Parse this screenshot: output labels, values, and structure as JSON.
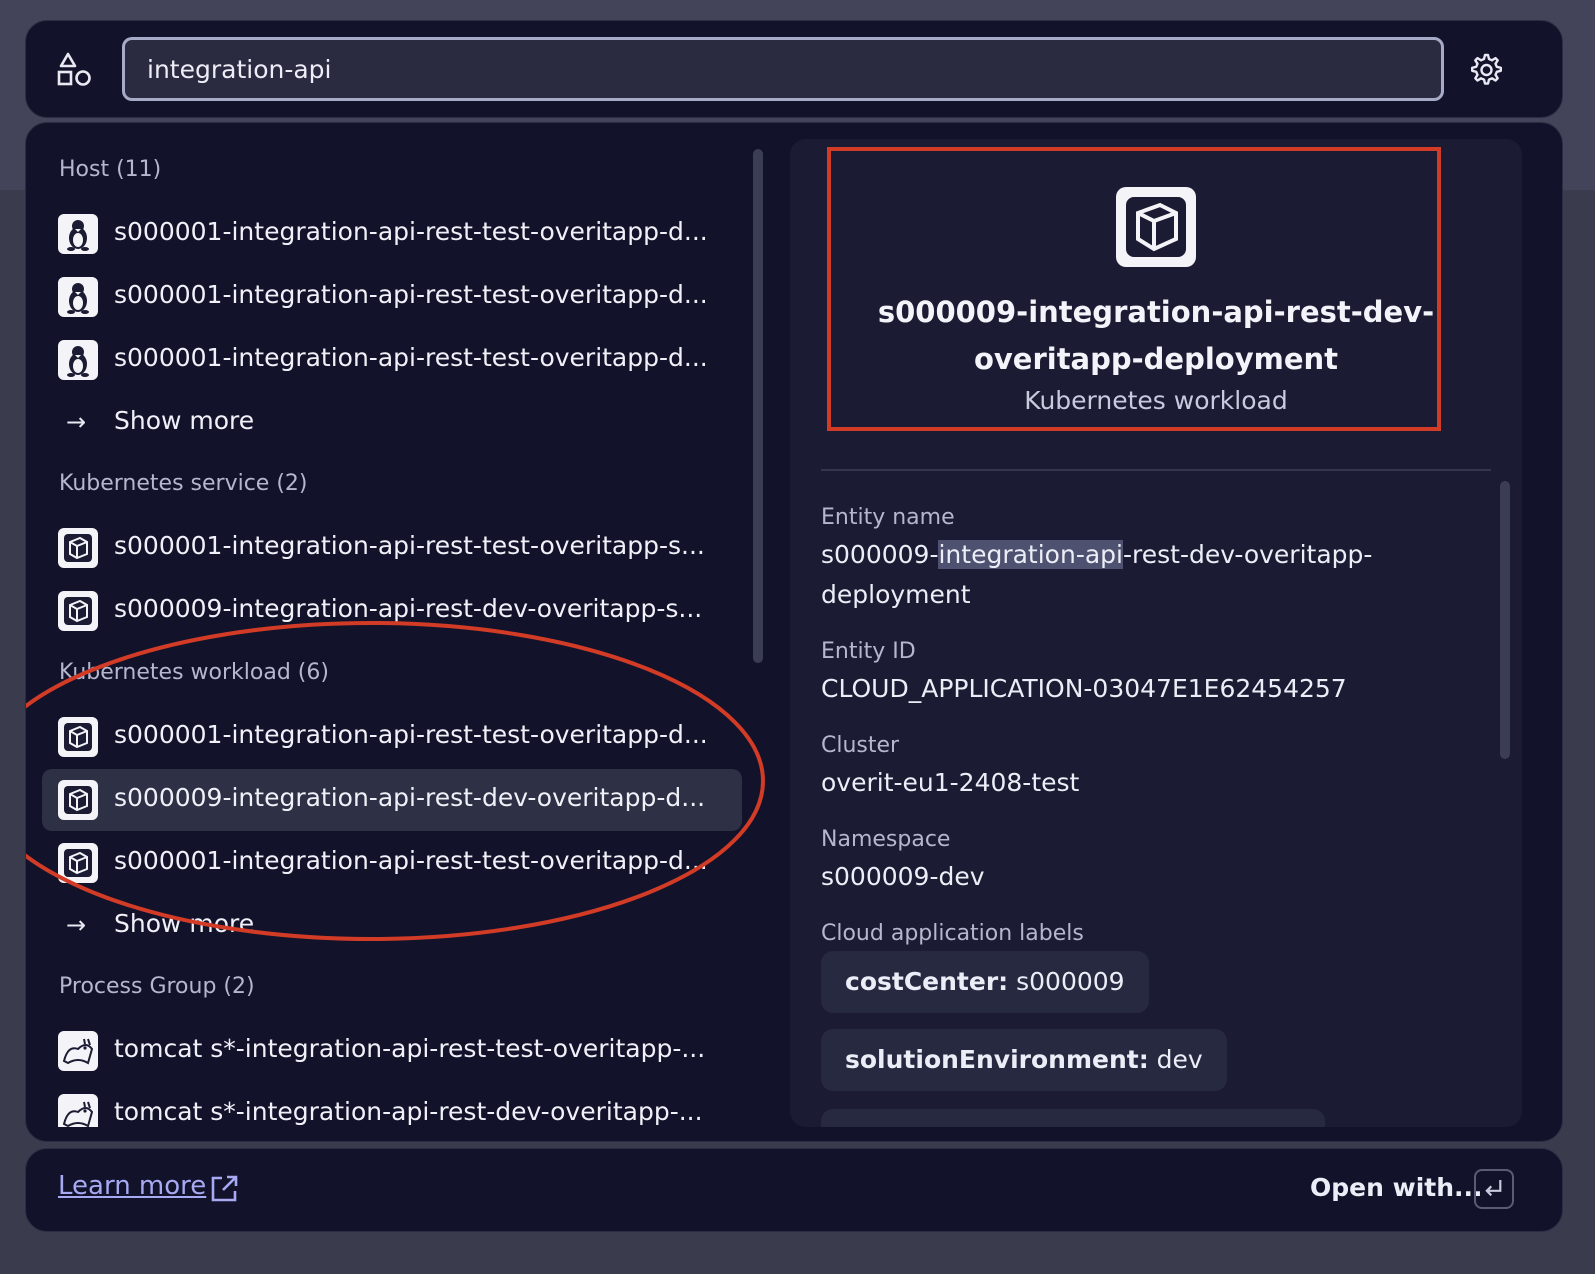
{
  "search": {
    "value": "integration-api",
    "settings_icon": "gear-icon",
    "left_icon": "shapes-icon"
  },
  "sections": [
    {
      "header": "Host (11)",
      "icon": "linux-tux-icon",
      "items": [
        "s000001-integration-api-rest-test-overitapp-d...",
        "s000001-integration-api-rest-test-overitapp-d...",
        "s000001-integration-api-rest-test-overitapp-d..."
      ],
      "show_more": "Show more"
    },
    {
      "header": "Kubernetes service (2)",
      "icon": "kubernetes-cube-icon",
      "items": [
        "s000001-integration-api-rest-test-overitapp-s...",
        "s000009-integration-api-rest-dev-overitapp-s..."
      ]
    },
    {
      "header": "Kubernetes workload (6)",
      "icon": "kubernetes-cube-icon",
      "items": [
        "s000001-integration-api-rest-test-overitapp-d...",
        "s000009-integration-api-rest-dev-overitapp-d...",
        "s000001-integration-api-rest-test-overitapp-d..."
      ],
      "selected_index": 1,
      "show_more": "Show more"
    },
    {
      "header": "Process Group (2)",
      "icon": "tomcat-icon",
      "items": [
        "tomcat s*-integration-api-rest-test-overitapp-...",
        "tomcat s*-integration-api-rest-dev-overitapp-..."
      ]
    }
  ],
  "detail": {
    "title_line1": "s000009-integration-api-rest-dev-",
    "title_line2": "overitapp-deployment",
    "type": "Kubernetes workload",
    "fields": {
      "entity_name_label": "Entity name",
      "entity_name_prefix": "s000009-",
      "entity_name_highlight": "integration-api",
      "entity_name_suffix": "-rest-dev-overitapp-",
      "entity_name_line2": "deployment",
      "entity_id_label": "Entity ID",
      "entity_id": "CLOUD_APPLICATION-03047E1E62454257",
      "cluster_label": "Cluster",
      "cluster": "overit-eu1-2408-test",
      "namespace_label": "Namespace",
      "namespace": "s000009-dev",
      "labels_label": "Cloud application labels"
    },
    "labels": [
      {
        "key": "costCenter:",
        "value": " s000009"
      },
      {
        "key": "solutionEnvironment:",
        "value": " dev"
      }
    ]
  },
  "footer": {
    "learn_more": "Learn more",
    "open_with": "Open with..."
  },
  "colors": {
    "annotation_red": "#d23b26",
    "link": "#a7a9f3",
    "panel_bg": "#12132a"
  }
}
